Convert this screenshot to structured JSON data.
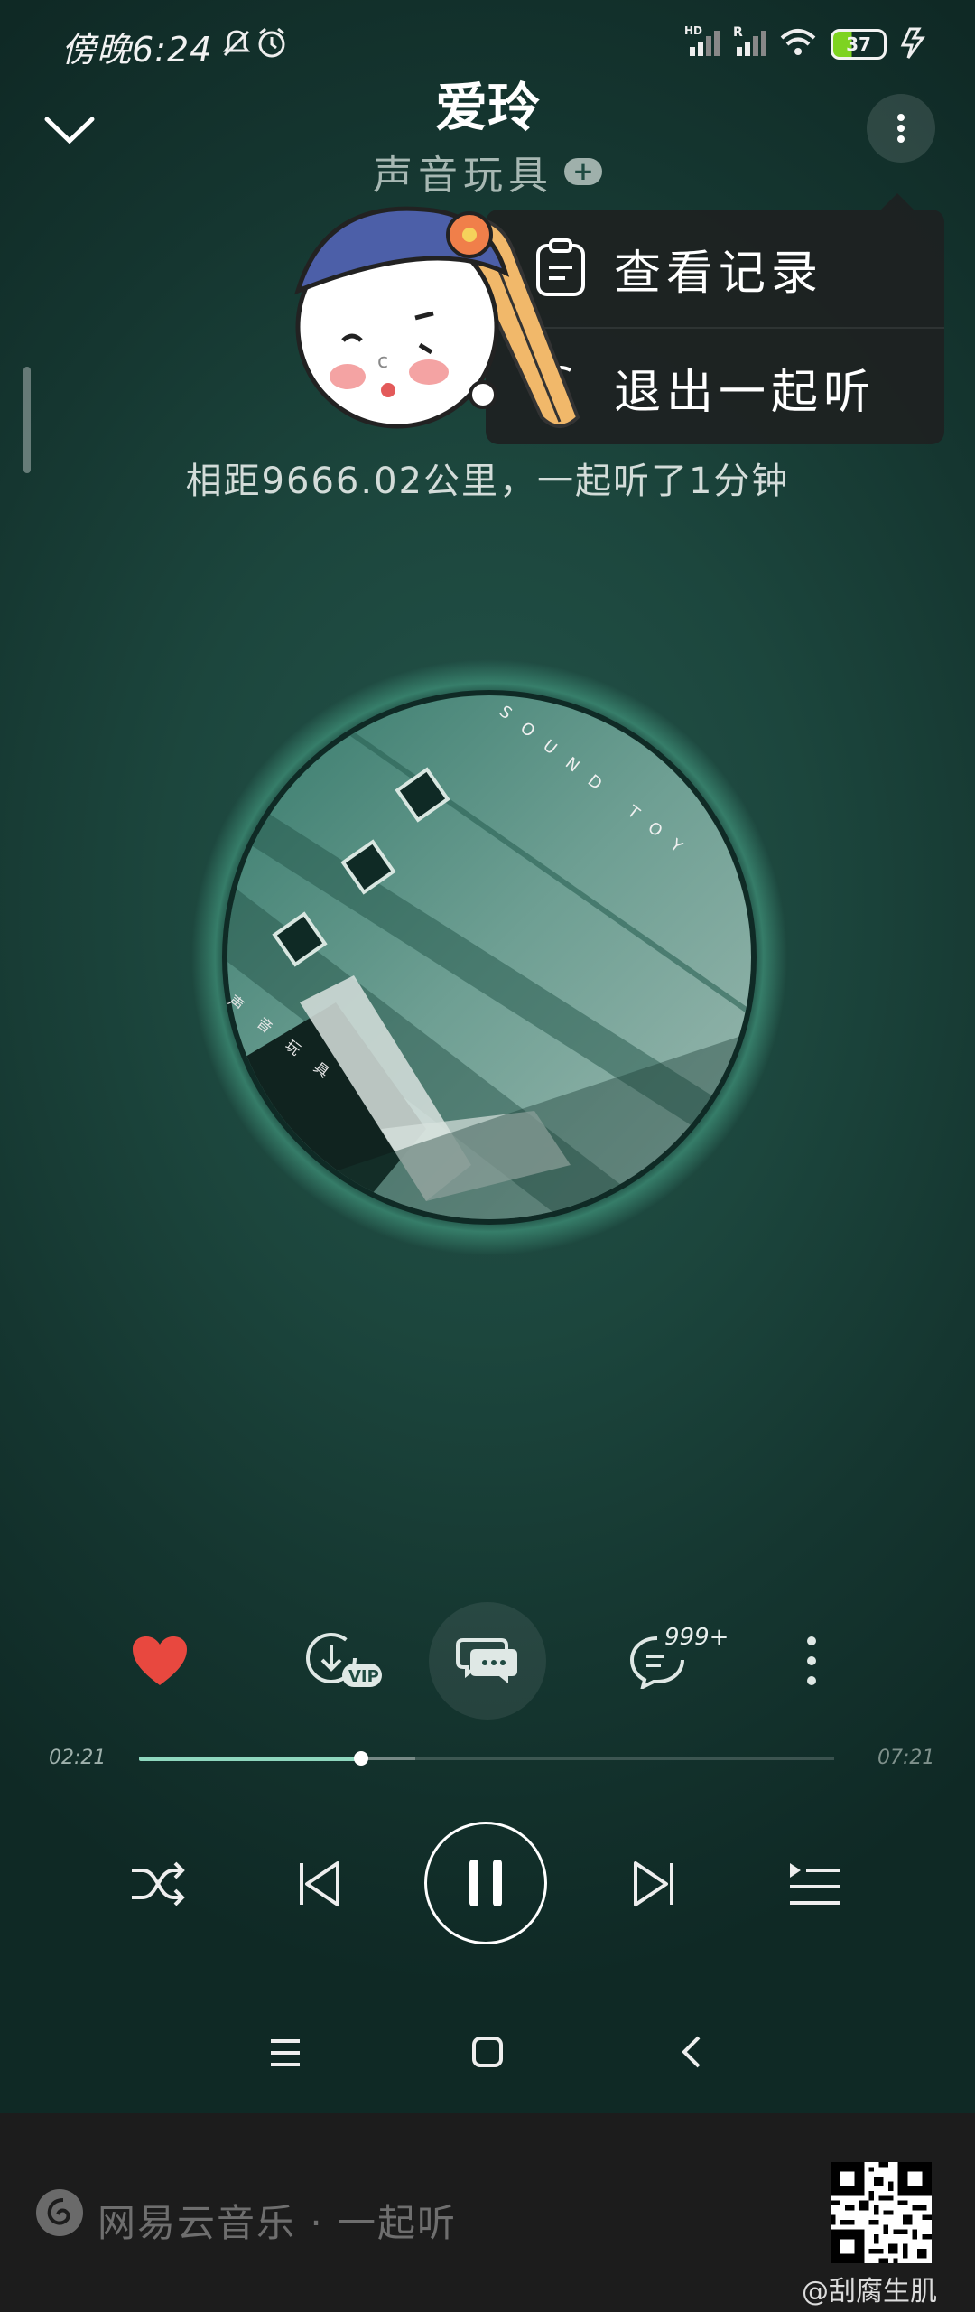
{
  "status": {
    "time": "傍晚6:24",
    "battery": "37",
    "signal1_tag": "HD",
    "signal2_tag": "R"
  },
  "header": {
    "title": "爱玲",
    "artist": "声音玩具",
    "follow_symbol": "+"
  },
  "menu": {
    "items": [
      {
        "label": "查看记录",
        "icon": "history-record-icon"
      },
      {
        "label": "退出一起听",
        "icon": "exit-listen-together-icon"
      }
    ]
  },
  "listen_together": {
    "distance_text": "相距9666.02公里，一起听了1分钟"
  },
  "album": {
    "band_text": "SOUND TOY",
    "cover_caption": "声音玩具"
  },
  "actions": {
    "like": "heart-icon",
    "download": "download-vip-icon",
    "vip_tag": "VIP",
    "chat": "chat-icon",
    "comment_count": "999+",
    "more": "more-vertical-icon"
  },
  "progress": {
    "current": "02:21",
    "total": "07:21",
    "played_fraction": 0.32
  },
  "controls": {
    "shuffle": "shuffle-icon",
    "prev": "previous-icon",
    "pause": "pause-icon",
    "next": "next-icon",
    "playlist": "playlist-icon"
  },
  "footer": {
    "app_name": "网易云音乐 · 一起听",
    "weibo_handle": "@刮腐生肌"
  },
  "colors": {
    "accent": "#8fd8bf",
    "like": "#e8483f",
    "background": "#1c463d"
  }
}
